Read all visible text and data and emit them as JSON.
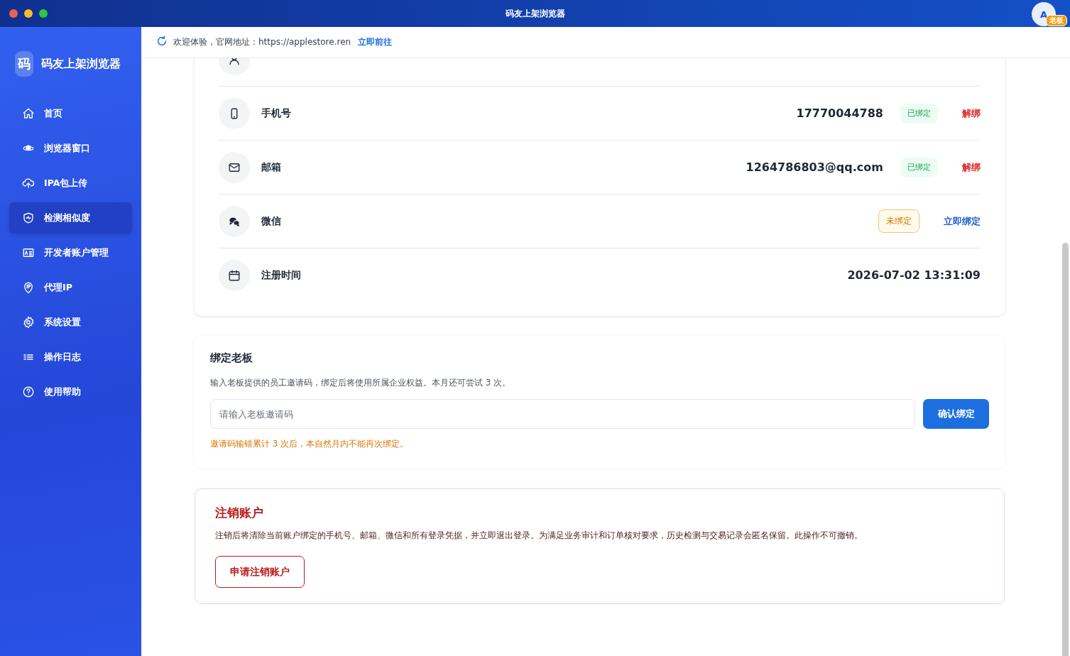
{
  "window": {
    "title": "码友上架浏览器"
  },
  "user": {
    "avatar": "A",
    "badge": "老板"
  },
  "sidebar": {
    "logo_mark": "码",
    "app_name": "码友上架浏览器",
    "items": [
      {
        "label": "首页",
        "kind": "home",
        "selected": false
      },
      {
        "label": "浏览器窗口",
        "kind": "planet",
        "selected": false
      },
      {
        "label": "IPA包上传",
        "kind": "upload",
        "selected": false
      },
      {
        "label": "检测相似度",
        "kind": "shield",
        "selected": true
      },
      {
        "label": "开发者账户管理",
        "kind": "card",
        "selected": false
      },
      {
        "label": "代理IP",
        "kind": "pin",
        "selected": false
      },
      {
        "label": "系统设置",
        "kind": "gear",
        "selected": false
      },
      {
        "label": "操作日志",
        "kind": "list",
        "selected": false
      },
      {
        "label": "使用帮助",
        "kind": "help",
        "selected": false
      }
    ]
  },
  "notice": {
    "text": "欢迎体验，官网地址：https://applestore.ren",
    "link": "立即前往"
  },
  "account_rows": [
    {
      "kind": "phone",
      "label": "手机号",
      "value": "17770044788",
      "status": {
        "kind": "bound",
        "text": "已绑定"
      },
      "action": {
        "kind": "danger",
        "text": "解绑"
      }
    },
    {
      "kind": "email",
      "label": "邮箱",
      "value": "1264786803@qq.com",
      "status": {
        "kind": "bound",
        "text": "已绑定"
      },
      "action": {
        "kind": "danger",
        "text": "解绑"
      }
    },
    {
      "kind": "wechat",
      "label": "微信",
      "status": {
        "kind": "unbound",
        "text": "未绑定"
      },
      "action": {
        "kind": "link",
        "text": "立即绑定"
      }
    },
    {
      "kind": "date",
      "label": "注册时间",
      "value": "2026-07-02 13:31:09"
    }
  ],
  "bind_boss": {
    "title": "绑定老板",
    "description": "输入老板提供的员工邀请码，绑定后将使用所属企业权益。本月还可尝试 3 次。",
    "placeholder": "请输入老板邀请码",
    "button": "确认绑定",
    "warning": "邀请码输错累计 3 次后，本自然月内不能再次绑定。"
  },
  "delete_account": {
    "title": "注销账户",
    "description": "注销后将清除当前账户绑定的手机号、邮箱、微信和所有登录凭据，并立即退出登录。为满足业务审计和订单核对要求，历史检测与交易记录会匿名保留。此操作不可撤销。",
    "button": "申请注销账户"
  }
}
